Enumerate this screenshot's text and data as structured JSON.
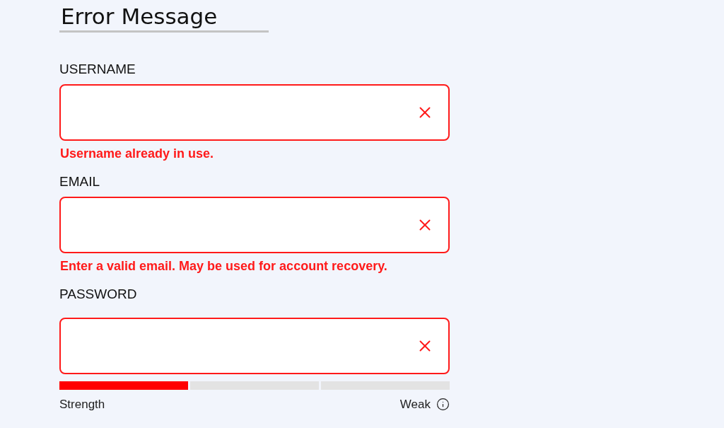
{
  "title": "Error Message",
  "fields": [
    {
      "label": "USERNAME",
      "invalid": true,
      "error": "Username already in use."
    },
    {
      "label": "EMAIL",
      "invalid": true,
      "error": "Enter a valid email. May be used for account recovery."
    },
    {
      "label": "PASSWORD",
      "invalid": true
    }
  ],
  "strength": {
    "segments": [
      {
        "filled": true
      },
      {
        "filled": false
      },
      {
        "filled": false
      }
    ],
    "label": "Strength",
    "rating": "Weak"
  }
}
